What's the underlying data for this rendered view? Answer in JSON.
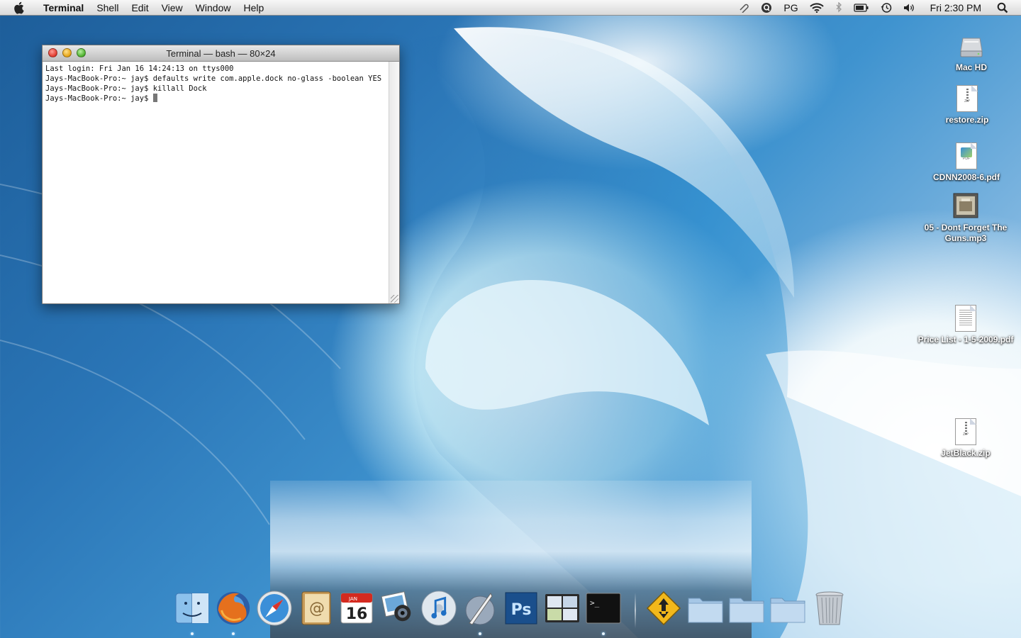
{
  "menubar": {
    "app_name": "Terminal",
    "items": [
      "Shell",
      "Edit",
      "View",
      "Window",
      "Help"
    ],
    "status_pg": "PG",
    "clock": "Fri 2:30 PM"
  },
  "terminal": {
    "title": "Terminal — bash — 80×24",
    "lines": [
      "Last login: Fri Jan 16 14:24:13 on ttys000",
      "Jays-MacBook-Pro:~ jay$ defaults write com.apple.dock no-glass -boolean YES",
      "Jays-MacBook-Pro:~ jay$ killall Dock",
      "Jays-MacBook-Pro:~ jay$ "
    ]
  },
  "desktop": {
    "icons": [
      {
        "label": "Mac HD"
      },
      {
        "label": "restore.zip",
        "tag": "ZIP"
      },
      {
        "label": "CDNN2008-6.pdf",
        "tag": "PDF"
      },
      {
        "label": "05 - Dont Forget The Guns.mp3"
      },
      {
        "label": "Price List - 1-5-2009.pdf"
      },
      {
        "label": "JetBlack.zip",
        "tag": "ZIP"
      }
    ]
  },
  "dock": {
    "calendar_month": "JAN",
    "calendar_day": "16",
    "photoshop_label": "Ps",
    "terminal_prompt": ">_"
  },
  "colors": {
    "menubar": "#e6e6e6",
    "accent_blue": "#2a75b6"
  }
}
